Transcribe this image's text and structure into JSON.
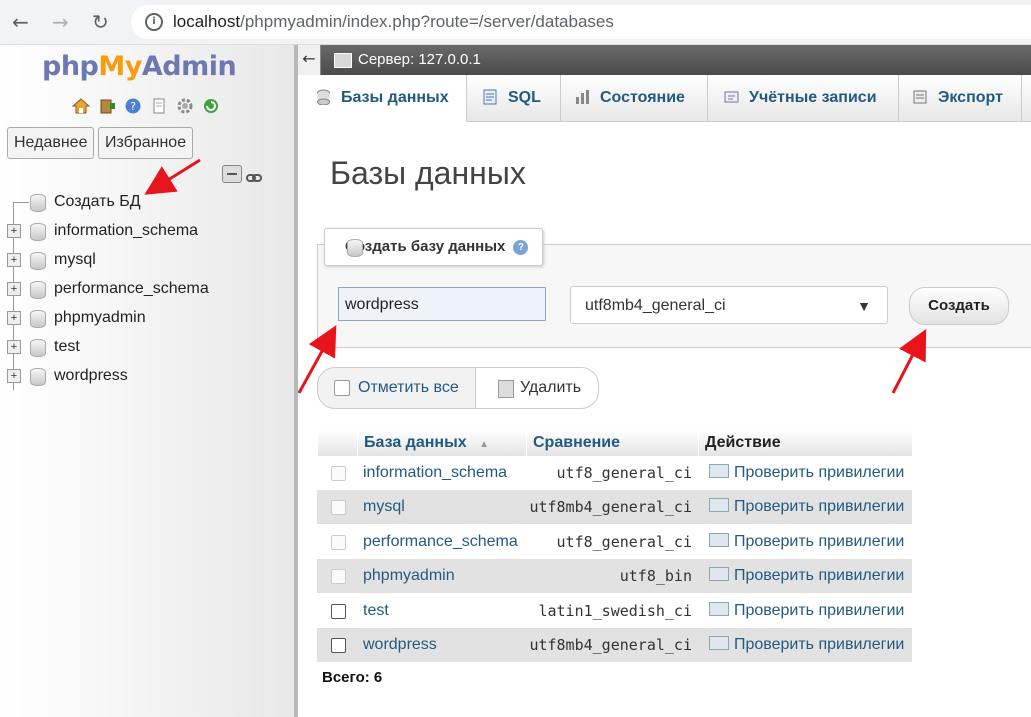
{
  "browser": {
    "url_host": "localhost",
    "url_path": "/phpmyadmin/index.php?route=/server/databases"
  },
  "nav": {
    "logo": {
      "php": "php",
      "my": "My",
      "admin": "Admin"
    },
    "icons": [
      "home-icon",
      "logout-icon",
      "help-icon",
      "docs-icon",
      "settings-icon",
      "reload-icon"
    ],
    "recent_label": "Недавнее",
    "favorites_label": "Избранное",
    "tree": {
      "create_label": "Создать БД",
      "databases": [
        "information_schema",
        "mysql",
        "performance_schema",
        "phpmyadmin",
        "test",
        "wordpress"
      ]
    }
  },
  "serverbar": {
    "back": "←",
    "server_label": "Сервер: 127.0.0.1"
  },
  "tabs": [
    {
      "label": "Базы данных",
      "icon": "database-icon",
      "active": true
    },
    {
      "label": "SQL",
      "icon": "sql-icon",
      "active": false
    },
    {
      "label": "Состояние",
      "icon": "status-icon",
      "active": false
    },
    {
      "label": "Учётные записи",
      "icon": "accounts-icon",
      "active": false
    },
    {
      "label": "Экспорт",
      "icon": "export-icon",
      "active": false
    }
  ],
  "page_title": "Базы данных",
  "create_form": {
    "legend": "Создать базу данных",
    "db_name_value": "wordpress",
    "collation_value": "utf8mb4_general_ci",
    "submit_label": "Создать"
  },
  "actions": {
    "check_all_label": "Отметить все",
    "delete_label": "Удалить"
  },
  "table": {
    "headers": {
      "database": "База данных",
      "sort_indicator": "▲",
      "collation": "Сравнение",
      "action": "Действие"
    },
    "rows": [
      {
        "name": "information_schema",
        "collation": "utf8_general_ci",
        "action": "Проверить привилегии",
        "checkbox_enabled": false
      },
      {
        "name": "mysql",
        "collation": "utf8mb4_general_ci",
        "action": "Проверить привилегии",
        "checkbox_enabled": false
      },
      {
        "name": "performance_schema",
        "collation": "utf8_general_ci",
        "action": "Проверить привилегии",
        "checkbox_enabled": false
      },
      {
        "name": "phpmyadmin",
        "collation": "utf8_bin",
        "action": "Проверить привилегии",
        "checkbox_enabled": false
      },
      {
        "name": "test",
        "collation": "latin1_swedish_ci",
        "action": "Проверить привилегии",
        "checkbox_enabled": true
      },
      {
        "name": "wordpress",
        "collation": "utf8mb4_general_ci",
        "action": "Проверить привилегии",
        "checkbox_enabled": true
      }
    ],
    "total_label": "Всего: 6"
  },
  "colors": {
    "link": "#235a81",
    "annotation_arrow": "#e8141b",
    "logo_blue": "#6c78af",
    "logo_orange": "#f89c0e"
  }
}
